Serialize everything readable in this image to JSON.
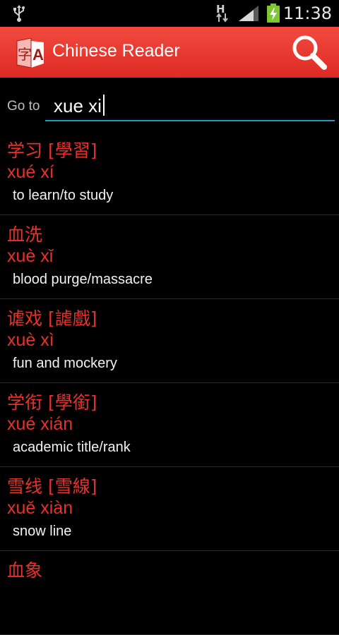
{
  "status_bar": {
    "network_type": "H",
    "time": "11:38"
  },
  "app": {
    "title": "Chinese Reader",
    "logo_letters": [
      "字",
      "A"
    ]
  },
  "goto": {
    "label": "Go to",
    "value": "xue xi"
  },
  "results": [
    {
      "hanzi": "学习 [學習]",
      "pinyin": "xué xí",
      "meaning": "to learn/to study"
    },
    {
      "hanzi": "血洗",
      "pinyin": "xuè xǐ",
      "meaning": "blood purge/massacre"
    },
    {
      "hanzi": "谑戏 [謔戲]",
      "pinyin": "xuè xì",
      "meaning": "fun and mockery"
    },
    {
      "hanzi": "学衔 [學銜]",
      "pinyin": "xué xián",
      "meaning": "academic title/rank"
    },
    {
      "hanzi": "雪线 [雪線]",
      "pinyin": "xuě xiàn",
      "meaning": "snow line"
    },
    {
      "hanzi": "血象",
      "pinyin": "",
      "meaning": ""
    }
  ],
  "colors": {
    "action_bar": "#e3332b",
    "accent_text": "#e8312a",
    "input_underline": "#2c93c9",
    "battery": "#7ec82f"
  }
}
